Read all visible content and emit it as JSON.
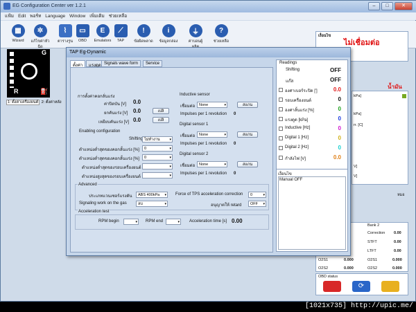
{
  "window": {
    "title": "EG Configuration Center ver 1.2.1",
    "icon": "app-icon"
  },
  "menu": [
    "แฟ้ม",
    "Edit",
    "พอร์ท",
    "Language",
    "Window",
    "เพิ่มเติม",
    "ช่วยเหลือ"
  ],
  "toolbar": [
    {
      "label": "Wizard",
      "icon": "grid-icon",
      "color": "#2a5db0"
    },
    {
      "label": "แก้ไขค่าหัวฉีด",
      "icon": "gear-icon",
      "color": "#2a5db0"
    },
    {
      "label": "ตารางรูน",
      "icon": "chart-icon",
      "color": "#2a5db0"
    },
    {
      "label": "OBD",
      "icon": "obd-icon",
      "color": "#2a5db0"
    },
    {
      "label": "Emulators",
      "icon": "e-icon",
      "color": "#2a5db0"
    },
    {
      "label": "TAP",
      "icon": "tap-icon",
      "color": "#2a5db0"
    },
    {
      "label": "ข้อผิดพลาด",
      "icon": "warning-icon",
      "color": "#2a5db0"
    },
    {
      "label": "ข้อมูลกล่อง",
      "icon": "info-icon",
      "color": "#2a5db0"
    },
    {
      "label": "ค่าบอนผู้ผลิต",
      "icon": "plug-icon",
      "color": "#2a5db0"
    },
    {
      "label": "ช่วยเหลือ",
      "icon": "help-icon",
      "color": "#2a5db0"
    }
  ],
  "gear": {
    "top": "G",
    "bottom": "R"
  },
  "left_tabs": [
    "1: ตั้งค่าเครื่องยนต์",
    "2: ตั้งค่าหลัง"
  ],
  "right": {
    "status_header": "เงื่อนไข",
    "connection": "ไม่เชื่อมต่อ",
    "fuel": "น้ำมัน",
    "side_rows": [
      "kPa]",
      "kPa]",
      "rr. [C]",
      "V]",
      "V]"
    ],
    "scale": "หมอ",
    "bank": {
      "left_title": "",
      "right_title": "Bank 2",
      "rows": [
        {
          "l": "",
          "lv": "",
          "r": "Correction",
          "rv": "0.00"
        },
        {
          "l": "",
          "lv": "",
          "r": "STFT",
          "rv": "0.00"
        },
        {
          "l": "",
          "lv": "",
          "r": "LTFT",
          "rv": "0.00"
        },
        {
          "l": "O2S1",
          "lv": "0.000",
          "r": "O2S1",
          "rv": "0.000"
        },
        {
          "l": "O2S2",
          "lv": "0.000",
          "r": "O2S2",
          "rv": "0.000"
        }
      ]
    },
    "obd_status": "OBD status"
  },
  "dialog": {
    "title": "TAP Eg-Dynamic",
    "tabs": [
      "ตั้งค่า",
      "แรงดูด",
      "Signals wave form",
      "Service"
    ],
    "voltage": {
      "title": "การตั้งค่าคอกลั่นแร่ง",
      "rows": [
        {
          "label": "ค่าปิดบัน [V]",
          "value": "0.0"
        },
        {
          "label": "ยกคันแร่ง [V]",
          "value": "0.0",
          "btn": "เปลิ"
        },
        {
          "label": "เหยียบคันแร่ง [V]",
          "value": "0.0",
          "btn": "เปลิ"
        }
      ]
    },
    "enabling": {
      "title": "Enabling configuration",
      "shifting_label": "Shifting",
      "shifting_value": "ไม่ทำงาน",
      "rows": [
        {
          "label": "ตำแหน่งต่ำสุดของคอกลั้นแร่ง [%]",
          "value": "0"
        },
        {
          "label": "ตำแหน่งต่ำสุดของคอกลั้นแร่ง [%]",
          "value": "0"
        },
        {
          "label": "ตำแหน่งต่ำสุดของรอบเครื่องยนต์",
          "value": ""
        },
        {
          "label": "ตำแหน่งสูงสุดของรอบเครื่องยนต์",
          "value": ""
        }
      ]
    },
    "inductive": {
      "title": "Inductive sensor",
      "connect_label": "เชื่อมต่อ",
      "connect_value": "None",
      "btn": "สแกน",
      "impulses_label": "Impulses per 1 revolution",
      "impulses_value": "0"
    },
    "digital1": {
      "title": "Digital sensor 1",
      "connect_label": "เชื่อมต่อ",
      "connect_value": "None",
      "btn": "สแกน",
      "impulses_label": "Impulses per 1 revolution",
      "impulses_value": "0"
    },
    "digital2": {
      "title": "Digital sensor 2",
      "connect_label": "เชื่อมต่อ",
      "connect_value": "None",
      "btn": "สแกน",
      "impulses_label": "Impulses per 1 revolution",
      "impulses_value": "0"
    },
    "advanced": {
      "title": "Advanced",
      "type_label": "ประเภทแวนเซอร์แรงดัน",
      "type_value": "ABS 400kPa",
      "gas_label": "Signaling work on the gas",
      "gas_value": "ลบ",
      "force_label": "Force of TPS acceleration correction",
      "force_value": "0",
      "retard_label": "อนุญาตให้ retard",
      "retard_value": "OFF"
    },
    "accel": {
      "title": "Acceleration test",
      "rpm_begin": "RPM begin",
      "rpm_end": "RPM end",
      "time_label": "Acceleration time [s]",
      "time_value": "0.00"
    },
    "readings": {
      "title": "Readings",
      "items": [
        {
          "label": "Shifting",
          "value": "OFF",
          "cb": false,
          "color": "#111"
        },
        {
          "label": "แก๊ส",
          "value": "OFF",
          "cb": false,
          "color": "#111"
        },
        {
          "label": "องศาเบอร์ระปิด [']",
          "value": "0.0",
          "cb": true,
          "color": "#e01818"
        },
        {
          "label": "รอบเครื่องยนต์",
          "value": "0",
          "cb": true,
          "color": "#111"
        },
        {
          "label": "องศาลั้นแร่ง [%]",
          "value": "0",
          "cb": true,
          "color": "#1aa01a"
        },
        {
          "label": "แรงดูด [kPa]",
          "value": "0",
          "cb": true,
          "color": "#1a3ae0"
        },
        {
          "label": "Inductive [Hz]",
          "value": "0",
          "cb": true,
          "color": "#d018d0"
        },
        {
          "label": "Digital 1 [Hz]",
          "value": "0",
          "cb": true,
          "color": "#d0b018"
        },
        {
          "label": "Digital 2 [Hz]",
          "value": "0",
          "cb": true,
          "color": "#18d0d0"
        },
        {
          "label": "กำลังไฟ [V]",
          "value": "0.0",
          "cb": true,
          "color": "#e08018"
        }
      ]
    },
    "conditions": {
      "title": "เงื่อนไข",
      "log": "Manual OFF"
    }
  },
  "caption": "[1021x735] http://upic.me/"
}
